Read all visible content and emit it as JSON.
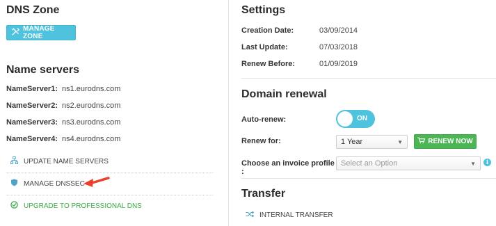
{
  "dns_zone": {
    "title": "DNS Zone",
    "manage_zone_button": "MANAGE ZONE"
  },
  "name_servers": {
    "title": "Name servers",
    "rows": [
      {
        "label": "NameServer1:",
        "value": "ns1.eurodns.com"
      },
      {
        "label": "NameServer2:",
        "value": "ns2.eurodns.com"
      },
      {
        "label": "NameServer3:",
        "value": "ns3.eurodns.com"
      },
      {
        "label": "NameServer4:",
        "value": "ns4.eurodns.com"
      }
    ],
    "actions": {
      "update": "UPDATE NAME SERVERS",
      "dnssec": "MANAGE DNSSEC",
      "upgrade": "UPGRADE TO PROFESSIONAL DNS"
    }
  },
  "settings": {
    "title": "Settings",
    "rows": [
      {
        "label": "Creation Date:",
        "value": "03/09/2014"
      },
      {
        "label": "Last Update:",
        "value": "07/03/2018"
      },
      {
        "label": "Renew Before:",
        "value": "01/09/2019"
      }
    ]
  },
  "domain_renewal": {
    "title": "Domain renewal",
    "auto_renew_label": "Auto-renew:",
    "auto_renew_state": "ON",
    "renew_for_label": "Renew for:",
    "renew_for_value": "1 Year",
    "renew_now_button": "RENEW NOW",
    "invoice_label": "Choose an invoice profile :",
    "invoice_placeholder": "Select an Option"
  },
  "transfer": {
    "title": "Transfer",
    "internal_transfer": "INTERNAL TRANSFER"
  },
  "colors": {
    "accent": "#4fc3dd",
    "success": "#4cb655",
    "annotation_arrow": "#e8412c"
  }
}
